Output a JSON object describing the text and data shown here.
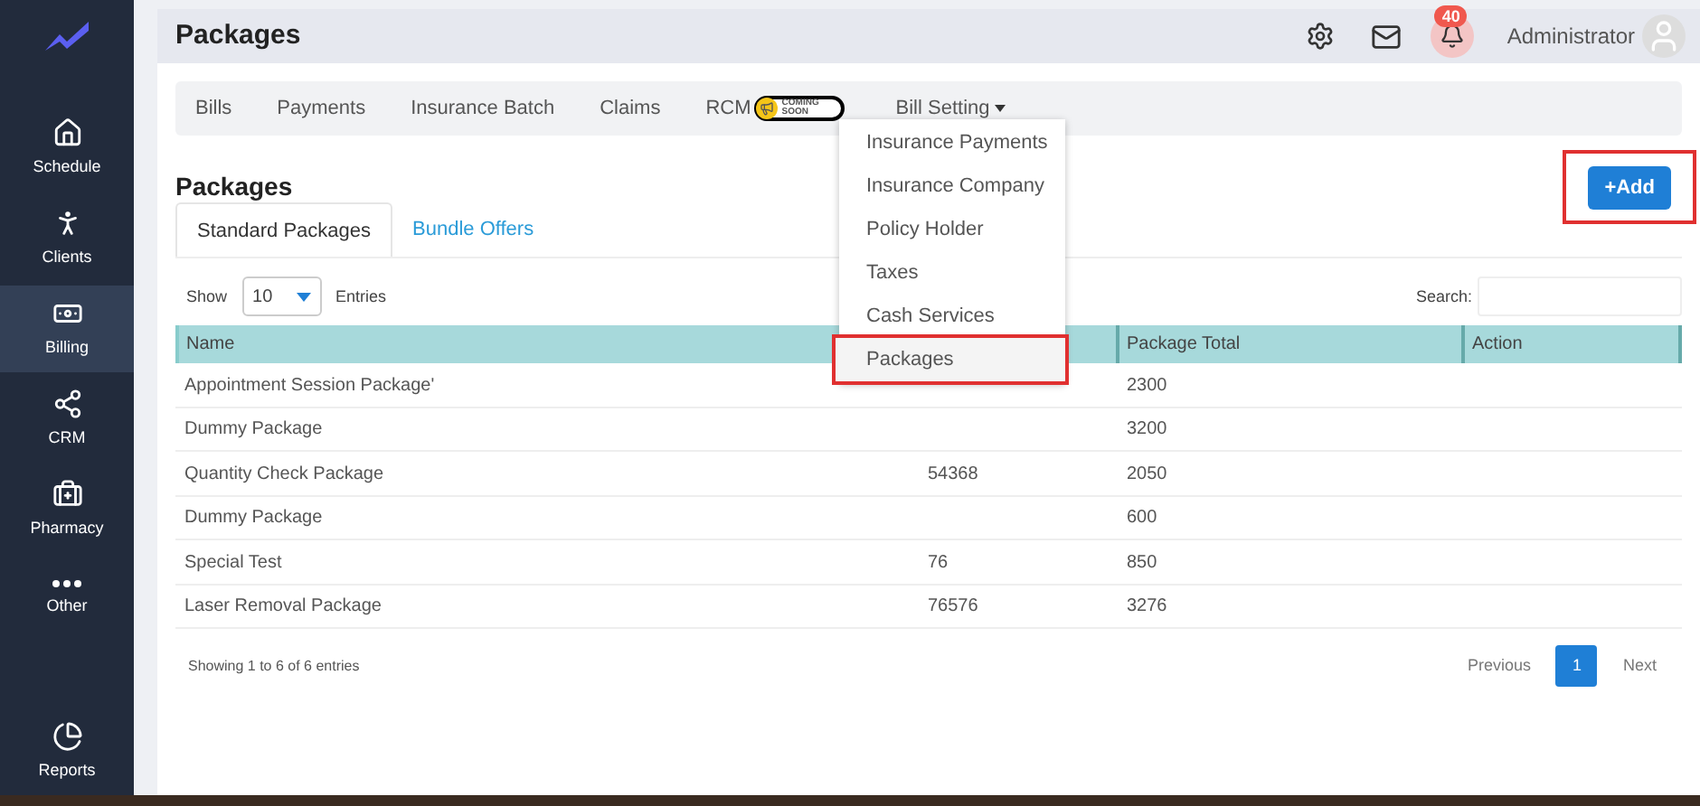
{
  "sidebar": {
    "items": [
      {
        "label": "Schedule",
        "selected": false
      },
      {
        "label": "Clients",
        "selected": false
      },
      {
        "label": "Billing",
        "selected": true
      },
      {
        "label": "CRM",
        "selected": false
      },
      {
        "label": "Pharmacy",
        "selected": false
      },
      {
        "label": "Other",
        "selected": false
      }
    ],
    "footer_item": {
      "label": "Reports",
      "selected": false
    }
  },
  "header": {
    "title": "Packages",
    "notification_count": "40",
    "user": "Administrator"
  },
  "nav": {
    "items": [
      {
        "label": "Bills",
        "kind": "link"
      },
      {
        "label": "Payments",
        "kind": "link"
      },
      {
        "label": "Insurance Batch",
        "kind": "link"
      },
      {
        "label": "Claims",
        "kind": "link"
      },
      {
        "label": "RCM",
        "kind": "badge",
        "badge": "COMING SOON"
      },
      {
        "label": "Bill Setting",
        "kind": "dropdown",
        "expanded": true
      }
    ],
    "menu": [
      {
        "label": "Insurance Payments",
        "selected": false
      },
      {
        "label": "Insurance Company",
        "selected": false
      },
      {
        "label": "Policy Holder",
        "selected": false
      },
      {
        "label": "Taxes",
        "selected": false
      },
      {
        "label": "Cash Services",
        "selected": false
      },
      {
        "label": "Packages",
        "selected": true
      }
    ]
  },
  "page": {
    "title": "Packages",
    "add_button": {
      "label": "+Add",
      "highlighted": true
    }
  },
  "tabs": [
    {
      "label": "Standard Packages",
      "selected": true
    },
    {
      "label": "Bundle Offers",
      "selected": false
    }
  ],
  "table": {
    "show_label": "Show",
    "page_size": "10",
    "entries_label": "Entries",
    "search_label": "Search:",
    "columns": {
      "column_1": "Name",
      "column_3": "Package Total",
      "column_4": "Action"
    },
    "rows": [
      {
        "name": "Appointment Session Package'",
        "total": "2300"
      },
      {
        "name": "Dummy Package",
        "total": "3200"
      },
      {
        "name": "Quantity Check Package",
        "column_2": "54368",
        "total": "2050"
      },
      {
        "name": "Dummy Package",
        "total": "600"
      },
      {
        "name": "Special Test",
        "column_2": "76",
        "total": "850"
      },
      {
        "name": "Laser Removal Package",
        "column_2": "76576",
        "total": "3276"
      }
    ],
    "info": "Showing 1 to 6 of 6 entries",
    "pagination": {
      "previous": "Previous",
      "pages": [
        {
          "label": "1",
          "selected": true
        }
      ],
      "next": "Next"
    }
  }
}
